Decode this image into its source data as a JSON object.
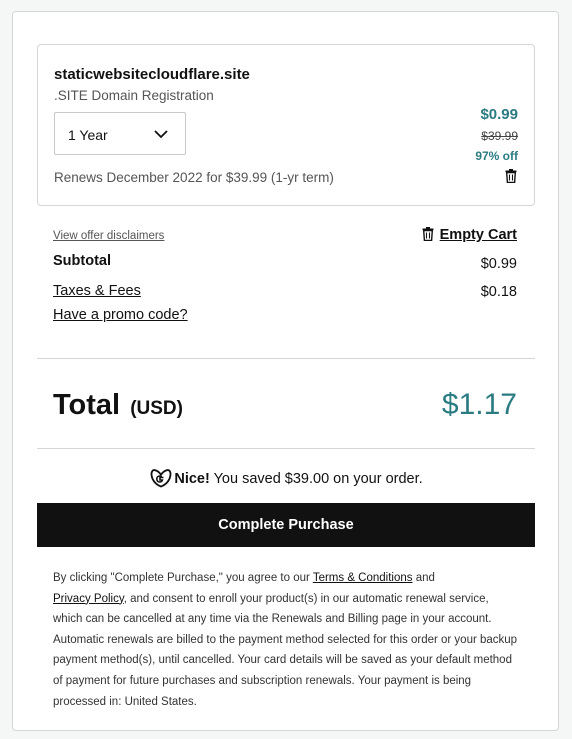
{
  "item": {
    "name": "staticwebsitecloudflare.site",
    "subtitle": ".SITE Domain Registration",
    "term": "1 Year",
    "renews": "Renews December 2022 for $39.99 (1-yr term)",
    "price": "$0.99",
    "original_price": "$39.99",
    "discount": "97% off"
  },
  "cart": {
    "disclaimers_link": "View offer disclaimers",
    "empty_cart": "Empty Cart",
    "subtotal_label": "Subtotal",
    "subtotal_value": "$0.99",
    "taxes_label": "Taxes & Fees",
    "taxes_value": "$0.18",
    "promo_link": "Have a promo code?"
  },
  "total": {
    "label": "Total",
    "currency": "(USD)",
    "value": "$1.17"
  },
  "savings": {
    "nice": "Nice!",
    "text": " You saved $39.00 on your order."
  },
  "purchase_button": "Complete Purchase",
  "legal": {
    "part1": "By clicking \"Complete Purchase,\" you agree to our ",
    "terms_link": "Terms & Conditions",
    "part2": " and ",
    "privacy_link": "Privacy Policy",
    "part3": ", and consent to enroll your product(s) in our automatic renewal service, which can be cancelled at any time via the Renewals and Billing page in your account. Automatic renewals are billed to the payment method selected for this order or your backup payment method(s), until cancelled. Your card details will be saved as your default method of payment for future purchases and subscription renewals. Your payment is being processed in: United States."
  },
  "colors": {
    "accent": "#2b7b82",
    "button_bg": "#111111"
  },
  "icons": [
    "chevron-down-icon",
    "trash-icon",
    "godaddy-logo-icon"
  ]
}
